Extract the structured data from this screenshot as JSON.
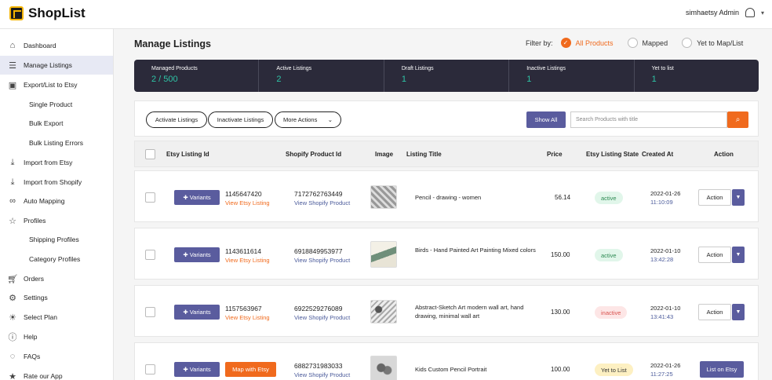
{
  "app": {
    "name": "ShopList"
  },
  "user": {
    "name": "simhaetsy Admin"
  },
  "sidebar": {
    "items": [
      {
        "label": "Dashboard",
        "icon": "home-icon"
      },
      {
        "label": "Manage Listings",
        "icon": "list-icon",
        "active": true
      },
      {
        "label": "Export/List to Etsy",
        "icon": "bag-icon"
      },
      {
        "label": "Single Product",
        "sub": true
      },
      {
        "label": "Bulk Export",
        "sub": true
      },
      {
        "label": "Bulk Listing Errors",
        "sub": true
      },
      {
        "label": "Import from Etsy",
        "icon": "import-icon"
      },
      {
        "label": "Import from Shopify",
        "icon": "import-icon"
      },
      {
        "label": "Auto Mapping",
        "icon": "link-icon"
      },
      {
        "label": "Profiles",
        "icon": "star-icon"
      },
      {
        "label": "Shipping Profiles",
        "sub": true
      },
      {
        "label": "Category Profiles",
        "sub": true
      },
      {
        "label": "Orders",
        "icon": "cart-icon"
      },
      {
        "label": "Settings",
        "icon": "gear-icon"
      },
      {
        "label": "Select Plan",
        "icon": "bulb-icon"
      },
      {
        "label": "Help",
        "icon": "help-icon"
      },
      {
        "label": "FAQs",
        "icon": "chat-icon"
      },
      {
        "label": "Rate our App",
        "icon": "star-icon"
      }
    ]
  },
  "main": {
    "title": "Manage Listings",
    "filter": {
      "label": "Filter by:",
      "options": [
        "All Products",
        "Mapped",
        "Yet to Map/List"
      ],
      "selected": "All Products"
    },
    "stats": [
      {
        "label": "Managed Products",
        "value": "2 / 500"
      },
      {
        "label": "Active Listings",
        "value": "2"
      },
      {
        "label": "Draft Listings",
        "value": "1"
      },
      {
        "label": "Inactive Listings",
        "value": "1"
      },
      {
        "label": "Yet to list",
        "value": "1"
      }
    ],
    "toolbar": {
      "activate": "Activate Listings",
      "inactivate": "Inactivate Listings",
      "more": "More Actions",
      "show_all": "Show All",
      "search_placeholder": "Search Products with title"
    },
    "columns": [
      "Etsy Listing Id",
      "Shopify Product Id",
      "Image",
      "Listing Title",
      "Price",
      "Etsy Listing State",
      "Created At",
      "Action"
    ],
    "rows": [
      {
        "variants": "Variants",
        "etsy_id": "1145647420",
        "etsy_link": "View Etsy Listing",
        "shopify_id": "7172762763449",
        "shopify_link": "View Shopify Product",
        "title": "Pencil - drawing - women",
        "price": "56.14",
        "state": "active",
        "date": "2022-01-26",
        "time": "11:10:09",
        "action": "Action"
      },
      {
        "variants": "Variants",
        "etsy_id": "1143611614",
        "etsy_link": "View Etsy Listing",
        "shopify_id": "6918849953977",
        "shopify_link": "View Shopify Product",
        "title": "Birds - Hand Painted Art Painting Mixed colors",
        "price": "150.00",
        "state": "active",
        "date": "2022-01-10",
        "time": "13:42:28",
        "action": "Action"
      },
      {
        "variants": "Variants",
        "etsy_id": "1157563967",
        "etsy_link": "View Etsy Listing",
        "shopify_id": "6922529276089",
        "shopify_link": "View Shopify Product",
        "title": "Abstract-Sketch Art modern wall art, hand drawing, minimal wall art",
        "price": "130.00",
        "state": "inactive",
        "date": "2022-01-10",
        "time": "13:41:43",
        "action": "Action"
      },
      {
        "variants": "Variants",
        "map_btn": "Map with Etsy",
        "shopify_id": "6882731983033",
        "shopify_link": "View Shopify Product",
        "title": "Kids Custom Pencil Portrait",
        "price": "100.00",
        "state": "Yet to List",
        "date": "2022-01-26",
        "time": "11:27:25",
        "action": "List on Etsy"
      }
    ]
  },
  "colors": {
    "accent": "#5a5c9e",
    "orange": "#f06a1d",
    "dark": "#2b2a3a",
    "teal": "#2ec4a6"
  }
}
